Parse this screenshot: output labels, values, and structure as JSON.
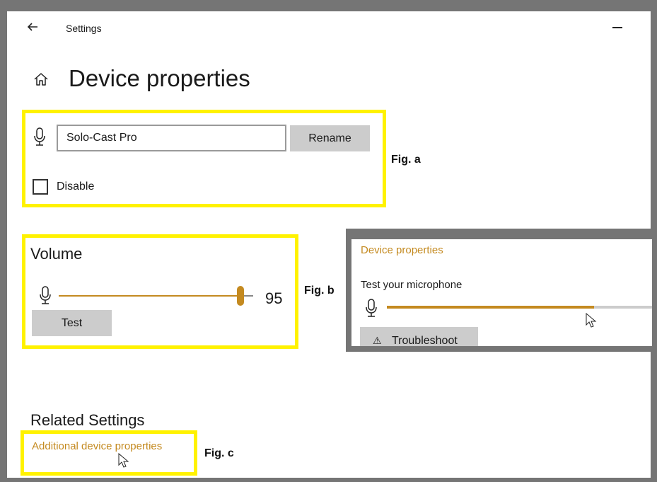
{
  "window": {
    "title": "Settings",
    "back_icon": "arrow-left-icon",
    "minimize_icon": "minimize-icon"
  },
  "page": {
    "home_icon": "home-icon",
    "title": "Device properties"
  },
  "device": {
    "mic_icon": "microphone-icon",
    "name_value": "Solo-Cast Pro",
    "rename_label": "Rename",
    "disable_label": "Disable",
    "disable_checked": false
  },
  "volume": {
    "title": "Volume",
    "level": 95,
    "value_text": "95",
    "test_label": "Test"
  },
  "inset": {
    "heading": "Device properties",
    "test_mic_label": "Test your microphone",
    "mic_level_fraction": 0.78,
    "troubleshoot_label": "Troubleshoot",
    "warning_icon": "warning-icon"
  },
  "related": {
    "title": "Related Settings",
    "link_label": "Additional device properties"
  },
  "figures": {
    "a": "Fig. a",
    "b": "Fig. b",
    "c": "Fig. c"
  },
  "colors": {
    "accent": "#c48a20",
    "highlight": "#fff200",
    "frame": "#757575",
    "button": "#cccccc"
  }
}
